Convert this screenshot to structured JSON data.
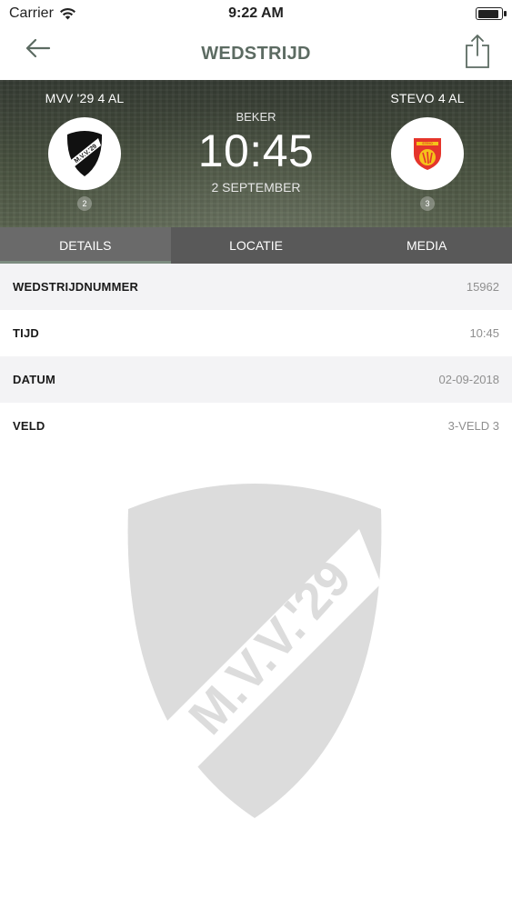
{
  "status_bar": {
    "carrier": "Carrier",
    "time": "9:22 AM",
    "battery_level": 0.95
  },
  "nav": {
    "title": "WEDSTRIJD",
    "back_icon": "arrow-left-icon",
    "share_icon": "share-icon"
  },
  "match": {
    "home_team": {
      "name": "MVV '29 4 AL",
      "rank": "2",
      "logo_text": "M.V.V.'29"
    },
    "away_team": {
      "name": "STEVO 4 AL",
      "rank": "3",
      "logo_text": "STEVO"
    },
    "competition": "BEKER",
    "time": "10:45",
    "date": "2 SEPTEMBER"
  },
  "tabs": [
    {
      "label": "DETAILS",
      "active": true
    },
    {
      "label": "LOCATIE",
      "active": false
    },
    {
      "label": "MEDIA",
      "active": false
    }
  ],
  "details": [
    {
      "label": "WEDSTRIJDNUMMER",
      "value": "15962"
    },
    {
      "label": "TIJD",
      "value": "10:45"
    },
    {
      "label": "DATUM",
      "value": "02-09-2018"
    },
    {
      "label": "VELD",
      "value": "3-VELD 3"
    }
  ],
  "watermark_text": "M.V.V.'29",
  "colors": {
    "title": "#5c6b62",
    "tab_bar": "#595959",
    "tab_indicator": "#7c8c80",
    "watermark": "#dcdcdc",
    "away_logo_red": "#e5352b",
    "away_logo_yellow": "#f5c21a"
  }
}
